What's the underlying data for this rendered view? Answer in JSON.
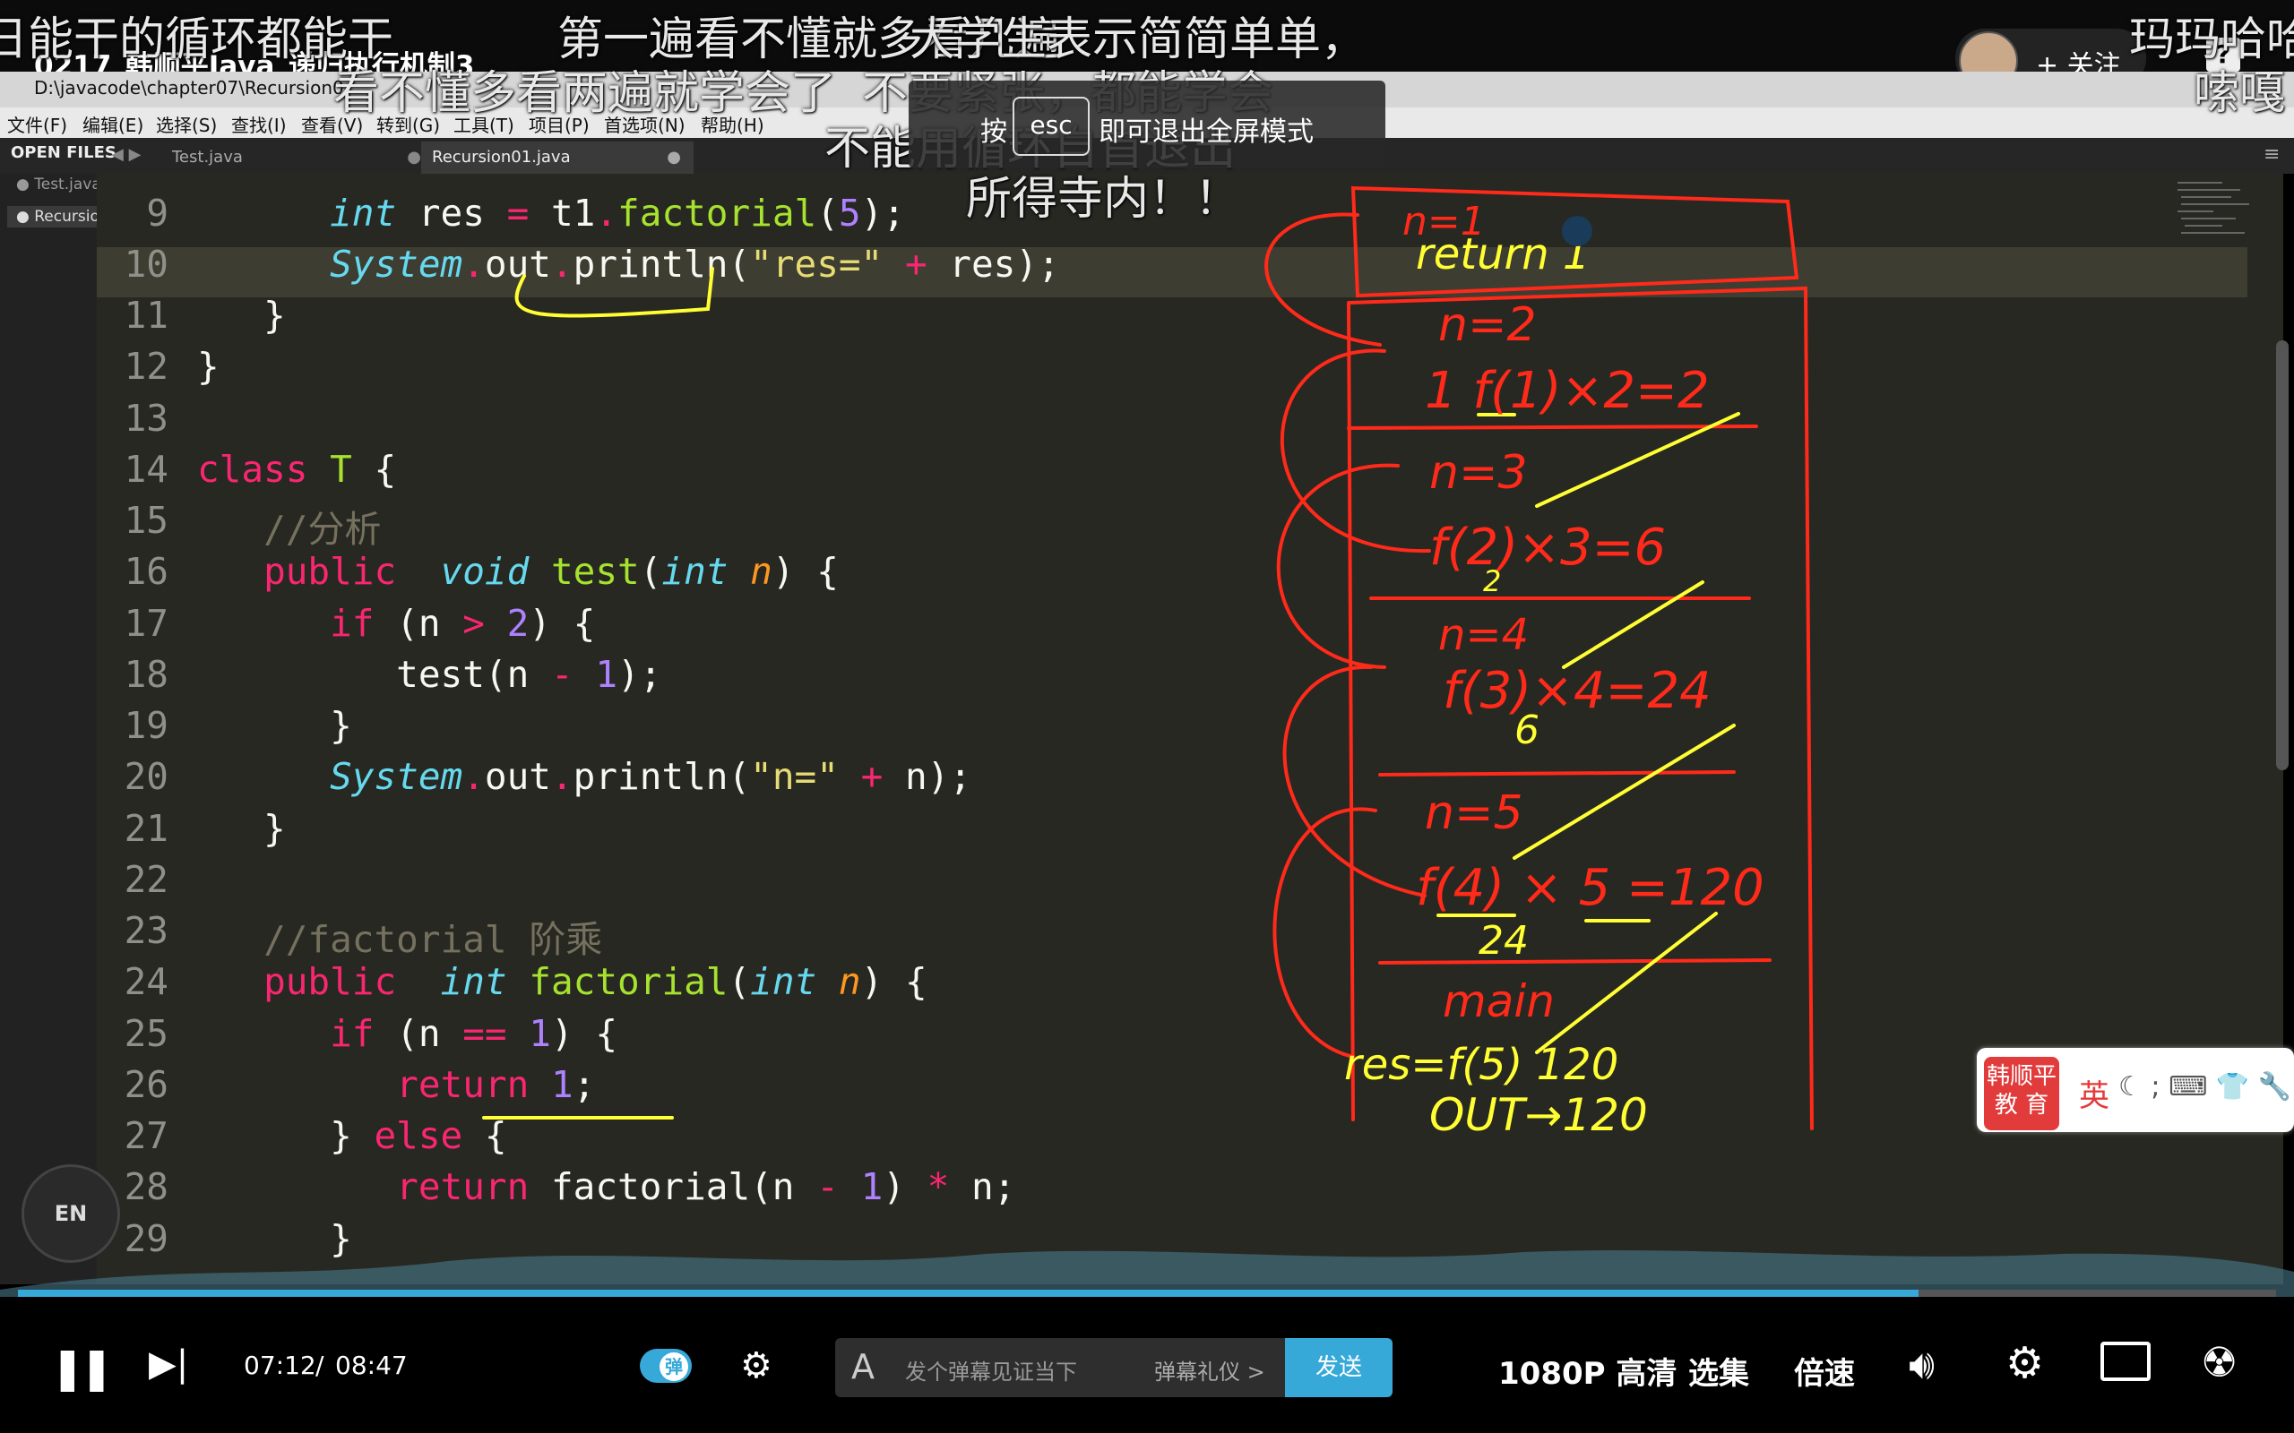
{
  "video": {
    "title": "0217_韩顺平Java_递归执行机制3",
    "follow_label": "+ 关注",
    "help_label": "?"
  },
  "danmaku": [
    {
      "text": "日能干的循环都能干"
    },
    {
      "text": "第一遍看不懂就多看几遍"
    },
    {
      "text": "大学生表示简简单单，"
    },
    {
      "text": "玛玛哈哈"
    },
    {
      "text": "看不懂多看两遍就学会了"
    },
    {
      "text": "不要紧张，都能学会"
    },
    {
      "text": "嗦嘎"
    },
    {
      "text": "不能用循环自首退出"
    },
    {
      "text": "所得寺内！！"
    }
  ],
  "esc_hint": {
    "pre": "按",
    "key": "esc",
    "post": "即可退出全屏模式"
  },
  "editor": {
    "path": "D:\\javacode\\chapter07\\Recursion0",
    "menu": [
      "文件(F)",
      "编辑(E)",
      "选择(S)",
      "查找(I)",
      "查看(V)",
      "转到(G)",
      "工具(T)",
      "项目(P)",
      "首选项(N)",
      "帮助(H)"
    ],
    "open_files_label": "OPEN FILES",
    "tabs": [
      "Test.java",
      "Recursion01.java"
    ],
    "sidebar_files": [
      "Test.java",
      "Recursio"
    ],
    "line_numbers": [
      "9",
      "10",
      "11",
      "12",
      "13",
      "14",
      "15",
      "16",
      "17",
      "18",
      "19",
      "20",
      "21",
      "22",
      "23",
      "24",
      "25",
      "26",
      "27",
      "28",
      "29"
    ]
  },
  "ime": {
    "logo": "韩顺平 教 育",
    "lang": "英",
    "icons": "☾ ; ⌨ 👕 🔧"
  },
  "en_badge": "EN",
  "controls": {
    "progress": 0.8417,
    "time_current": "07:12",
    "time_separator": "/",
    "time_total": "08:47",
    "danmaku_toggle_icon": "弹",
    "danmaku_placeholder": "发个弹幕见证当下",
    "danmaku_etiquette": "弹幕礼仪 >",
    "send_label": "发送",
    "quality": "1080P 高清",
    "episodes": "选集",
    "speed": "倍速"
  },
  "annotations": {
    "stack_labels": [
      "n=1",
      "return 1",
      "n=2",
      "1 f(1)×2=2",
      "n=3",
      "f(2)×3=6",
      "2",
      "n=4",
      "f(3)×4=24",
      "6",
      "n=5",
      "f(4) × 5 =120",
      "24",
      "main",
      "res=f(5) 120",
      "OUT→120"
    ],
    "colors": {
      "red": "#ff2a1a",
      "yellow": "#ffff33",
      "accent": "#36a9d8"
    }
  }
}
